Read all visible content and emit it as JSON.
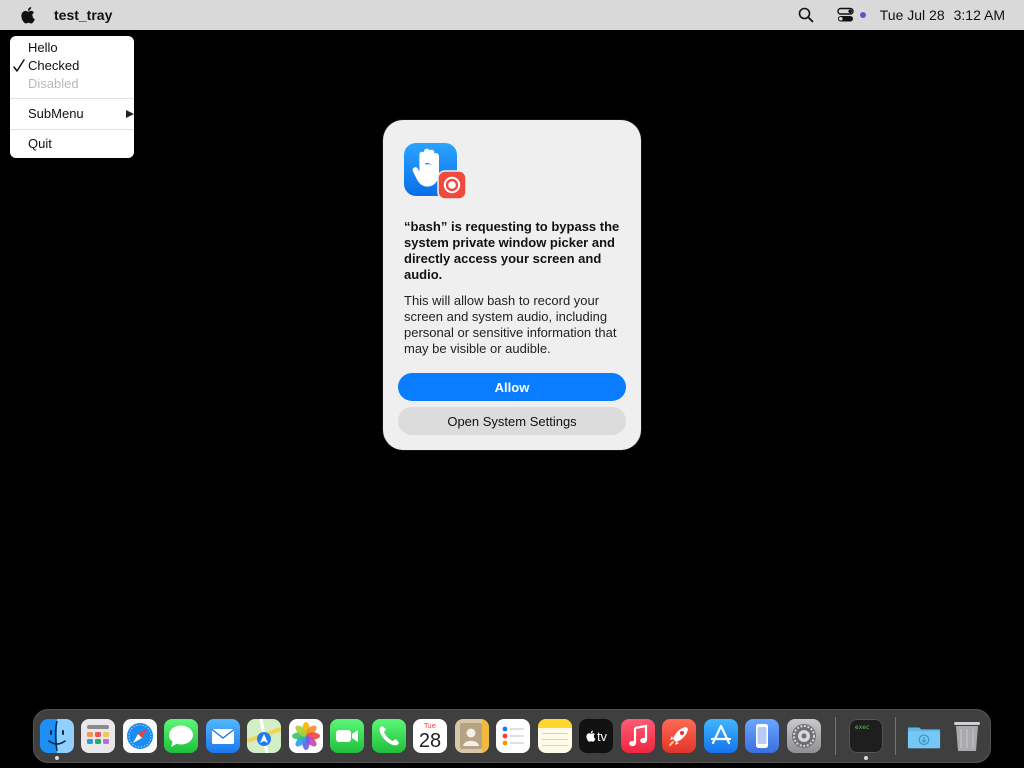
{
  "menubar": {
    "app_name": "test_tray",
    "icons": [
      "apple-logo",
      "search-icon",
      "control-center-icon",
      "recording-indicator-dot"
    ],
    "date": "Tue Jul 28",
    "time": "3:12 AM"
  },
  "tray_menu": {
    "items": [
      {
        "label": "Hello",
        "enabled": true,
        "checked": false
      },
      {
        "label": "Checked",
        "enabled": true,
        "checked": true
      },
      {
        "label": "Disabled",
        "enabled": false,
        "checked": false
      },
      {
        "label": "SubMenu",
        "enabled": true,
        "checked": false,
        "has_submenu": true
      },
      {
        "label": "Quit",
        "enabled": true,
        "checked": false
      }
    ]
  },
  "dialog": {
    "icon": "privacy-hand-with-screen-record-icon",
    "title": "“bash” is requesting to bypass the system private window picker and directly access your screen and audio.",
    "body": "This will allow bash to record your screen and system audio, including personal or sensitive information that may be visible or audible.",
    "allow_label": "Allow",
    "settings_label": "Open System Settings"
  },
  "dock": {
    "items": [
      {
        "name": "Finder",
        "icon": "finder-icon",
        "running": true
      },
      {
        "name": "Launchpad",
        "icon": "launchpad-icon",
        "running": false
      },
      {
        "name": "Safari",
        "icon": "safari-icon",
        "running": false
      },
      {
        "name": "Messages",
        "icon": "messages-icon",
        "running": false
      },
      {
        "name": "Mail",
        "icon": "mail-icon",
        "running": false
      },
      {
        "name": "Maps",
        "icon": "maps-icon",
        "running": false
      },
      {
        "name": "Photos",
        "icon": "photos-icon",
        "running": false
      },
      {
        "name": "FaceTime",
        "icon": "facetime-icon",
        "running": false
      },
      {
        "name": "Phone",
        "icon": "phone-icon",
        "running": false
      },
      {
        "name": "Calendar",
        "icon": "calendar-icon",
        "running": false
      },
      {
        "name": "Contacts",
        "icon": "contacts-icon",
        "running": false
      },
      {
        "name": "Reminders",
        "icon": "reminders-icon",
        "running": false
      },
      {
        "name": "Notes",
        "icon": "notes-icon",
        "running": false
      },
      {
        "name": "TV",
        "icon": "tv-icon",
        "running": false
      },
      {
        "name": "Music",
        "icon": "music-icon",
        "running": false
      },
      {
        "name": "Rocket",
        "icon": "rocket-icon",
        "running": false
      },
      {
        "name": "App Store",
        "icon": "app-store-icon",
        "running": false
      },
      {
        "name": "iPhone Mirroring",
        "icon": "iphone-mirroring-icon",
        "running": false
      },
      {
        "name": "System Settings",
        "icon": "system-settings-icon",
        "running": false
      },
      {
        "name": "Terminal",
        "icon": "terminal-icon",
        "running": true
      },
      {
        "name": "Downloads",
        "icon": "downloads-folder-icon",
        "running": false
      },
      {
        "name": "Trash",
        "icon": "trash-icon",
        "running": false
      }
    ],
    "calendar_month": "Tue",
    "calendar_day": "28",
    "tv_label": "tv",
    "terminal_label": "exec"
  },
  "colors": {
    "accent": "#0a7cff",
    "desktop": "#000000",
    "menubar": "#d9d9d9",
    "dialog_bg": "#efefef"
  }
}
